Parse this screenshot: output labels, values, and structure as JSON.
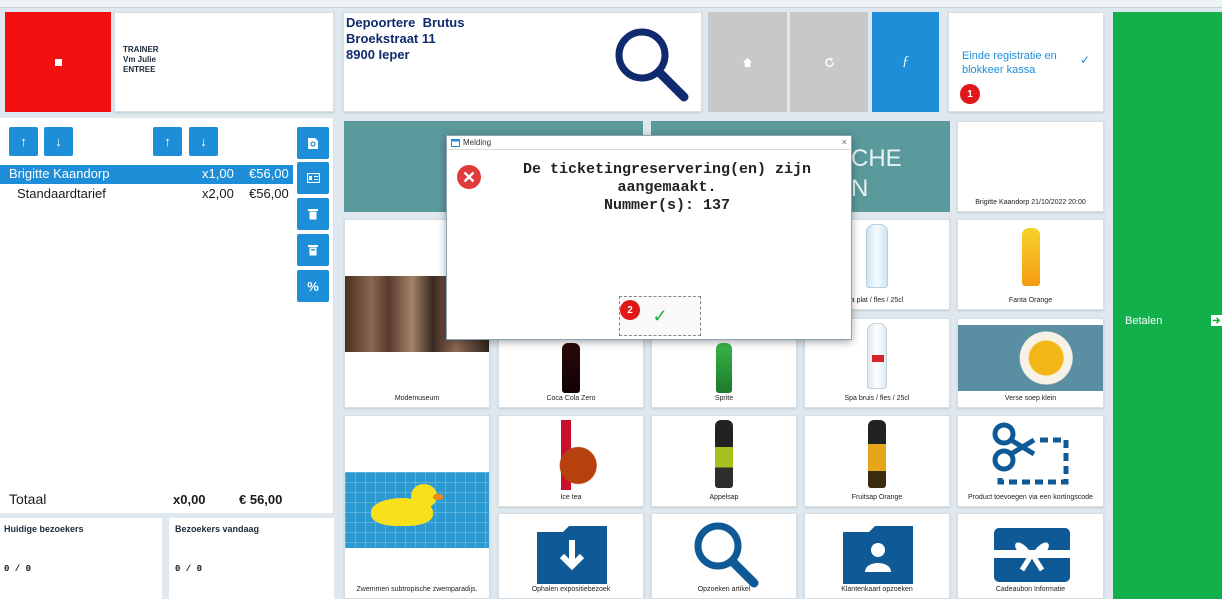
{
  "header": {
    "user_lines": [
      "TRAINER",
      "Vm Julie",
      "ENTREE"
    ],
    "customer": {
      "name": "Depoortere  Brutus",
      "street": "Broekstraat 11",
      "city": "8900 Ieper"
    },
    "end_registration_label": "Einde registratie en blokkeer kassa",
    "badge_1": "1"
  },
  "order": {
    "lines": [
      {
        "name": "Brigitte Kaandorp",
        "qty": "x1,00",
        "price": "€56,00"
      },
      {
        "name": "Standaardtarief",
        "qty": "x2,00",
        "price": "€56,00"
      }
    ],
    "total_label": "Totaal",
    "total_qty": "x0,00",
    "total_amount": "€ 56,00"
  },
  "visitors": {
    "current_label": "Huidige bezoekers",
    "current_value": "0 / 0",
    "today_label": "Bezoekers vandaag",
    "today_value": "0 / 0"
  },
  "pay_label": "Betalen",
  "category_tile_text": [
    "CHE",
    "N"
  ],
  "products": {
    "event": "Brigitte Kaandorp 21/10/2022 20:00",
    "spa_plat": "a plat / fles / 25cl",
    "fanta": "Fanta Orange",
    "modemuseum": "Modemuseum",
    "coca_zero": "Coca Cola Zero",
    "sprite": "Sprite",
    "spa_bruis": "Spa bruis / fles / 25cl",
    "soup": "Verse soep klein",
    "ice_tea": "Ice tea",
    "appelsap": "Appelsap",
    "fruitsap": "Fruitsap Orange",
    "discount": "Product toevoegen via een kortingscode",
    "swim": "Zwemmen subtropische zwemparadijs.",
    "expo": "Ophalen expositiebezoek",
    "search_article": "Opzoeken artikel",
    "customer_card": "Klantenkaart opzoeken",
    "voucher": "Cadeaubon Informatie"
  },
  "dialog": {
    "title": "Melding",
    "close_glyph": "×",
    "message_line1": "De ticketingreservering(en) zijn",
    "message_line2": "aangemaakt.",
    "message_line3": "Nummer(s): 137",
    "badge_2": "2"
  },
  "colors": {
    "accent": "#1e8ed8",
    "pay": "#12b04a",
    "stop": "#f21010",
    "category": "#5b9a9c"
  }
}
